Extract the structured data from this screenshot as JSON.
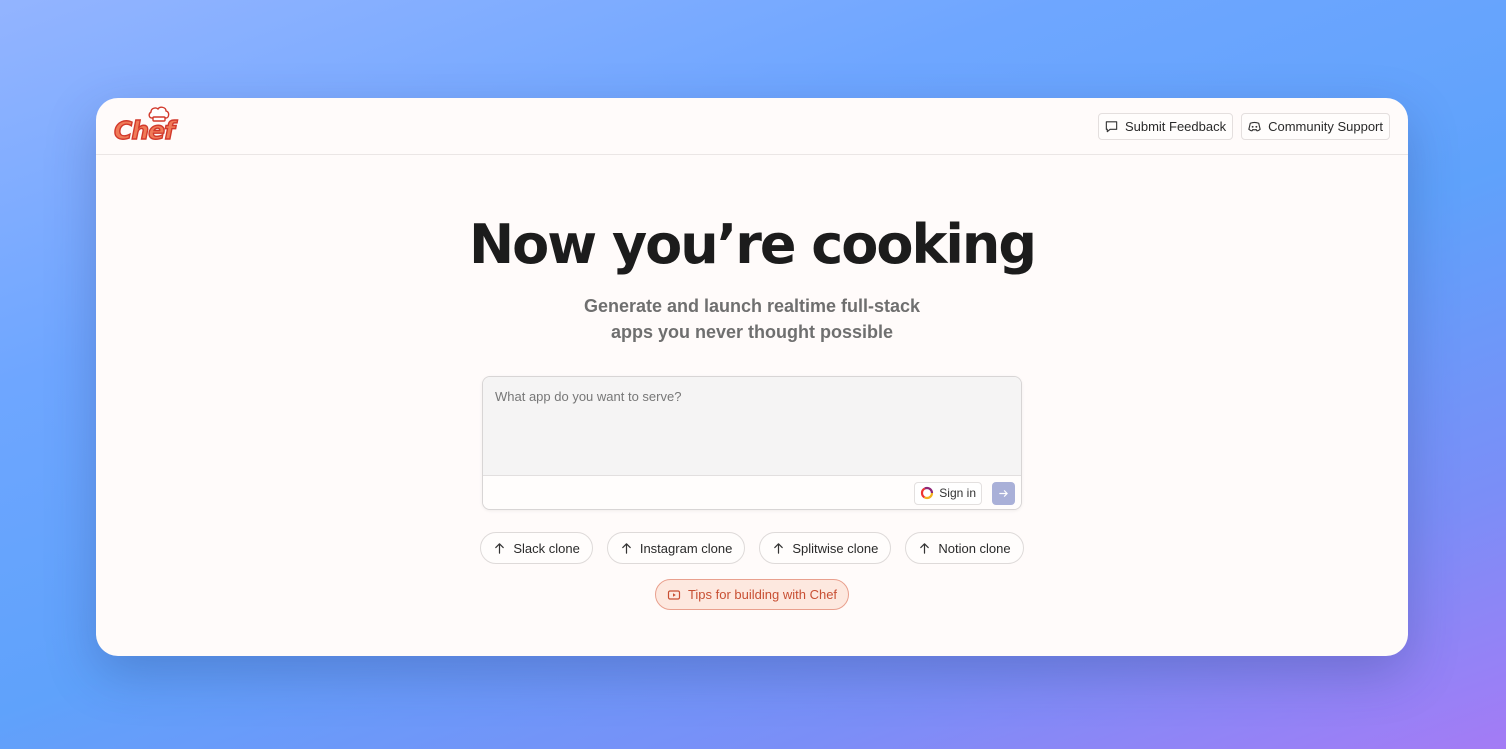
{
  "brand": {
    "logo_text": "Chef"
  },
  "header": {
    "feedback_label": "Submit Feedback",
    "support_label": "Community Support"
  },
  "hero": {
    "title": "Now you’re cooking",
    "subtitle_line1": "Generate and launch realtime full-stack",
    "subtitle_line2": "apps you never thought possible"
  },
  "prompt": {
    "placeholder": "What app do you want to serve?",
    "value": "",
    "signin_label": "Sign in"
  },
  "suggestions": [
    {
      "label": "Slack clone"
    },
    {
      "label": "Instagram clone"
    },
    {
      "label": "Splitwise clone"
    },
    {
      "label": "Notion clone"
    }
  ],
  "tips": {
    "label": "Tips for building with Chef"
  },
  "icons": {
    "feedback": "message-square-icon",
    "support": "discord-icon",
    "signin": "convex-logo-icon",
    "send": "arrow-right-icon",
    "suggestion": "arrow-up-icon",
    "tips": "video-icon"
  },
  "colors": {
    "brand": "#f07a58",
    "tips_text": "#c84f33",
    "tips_bg": "#fde8df",
    "send_bg": "#a9b0d8"
  }
}
